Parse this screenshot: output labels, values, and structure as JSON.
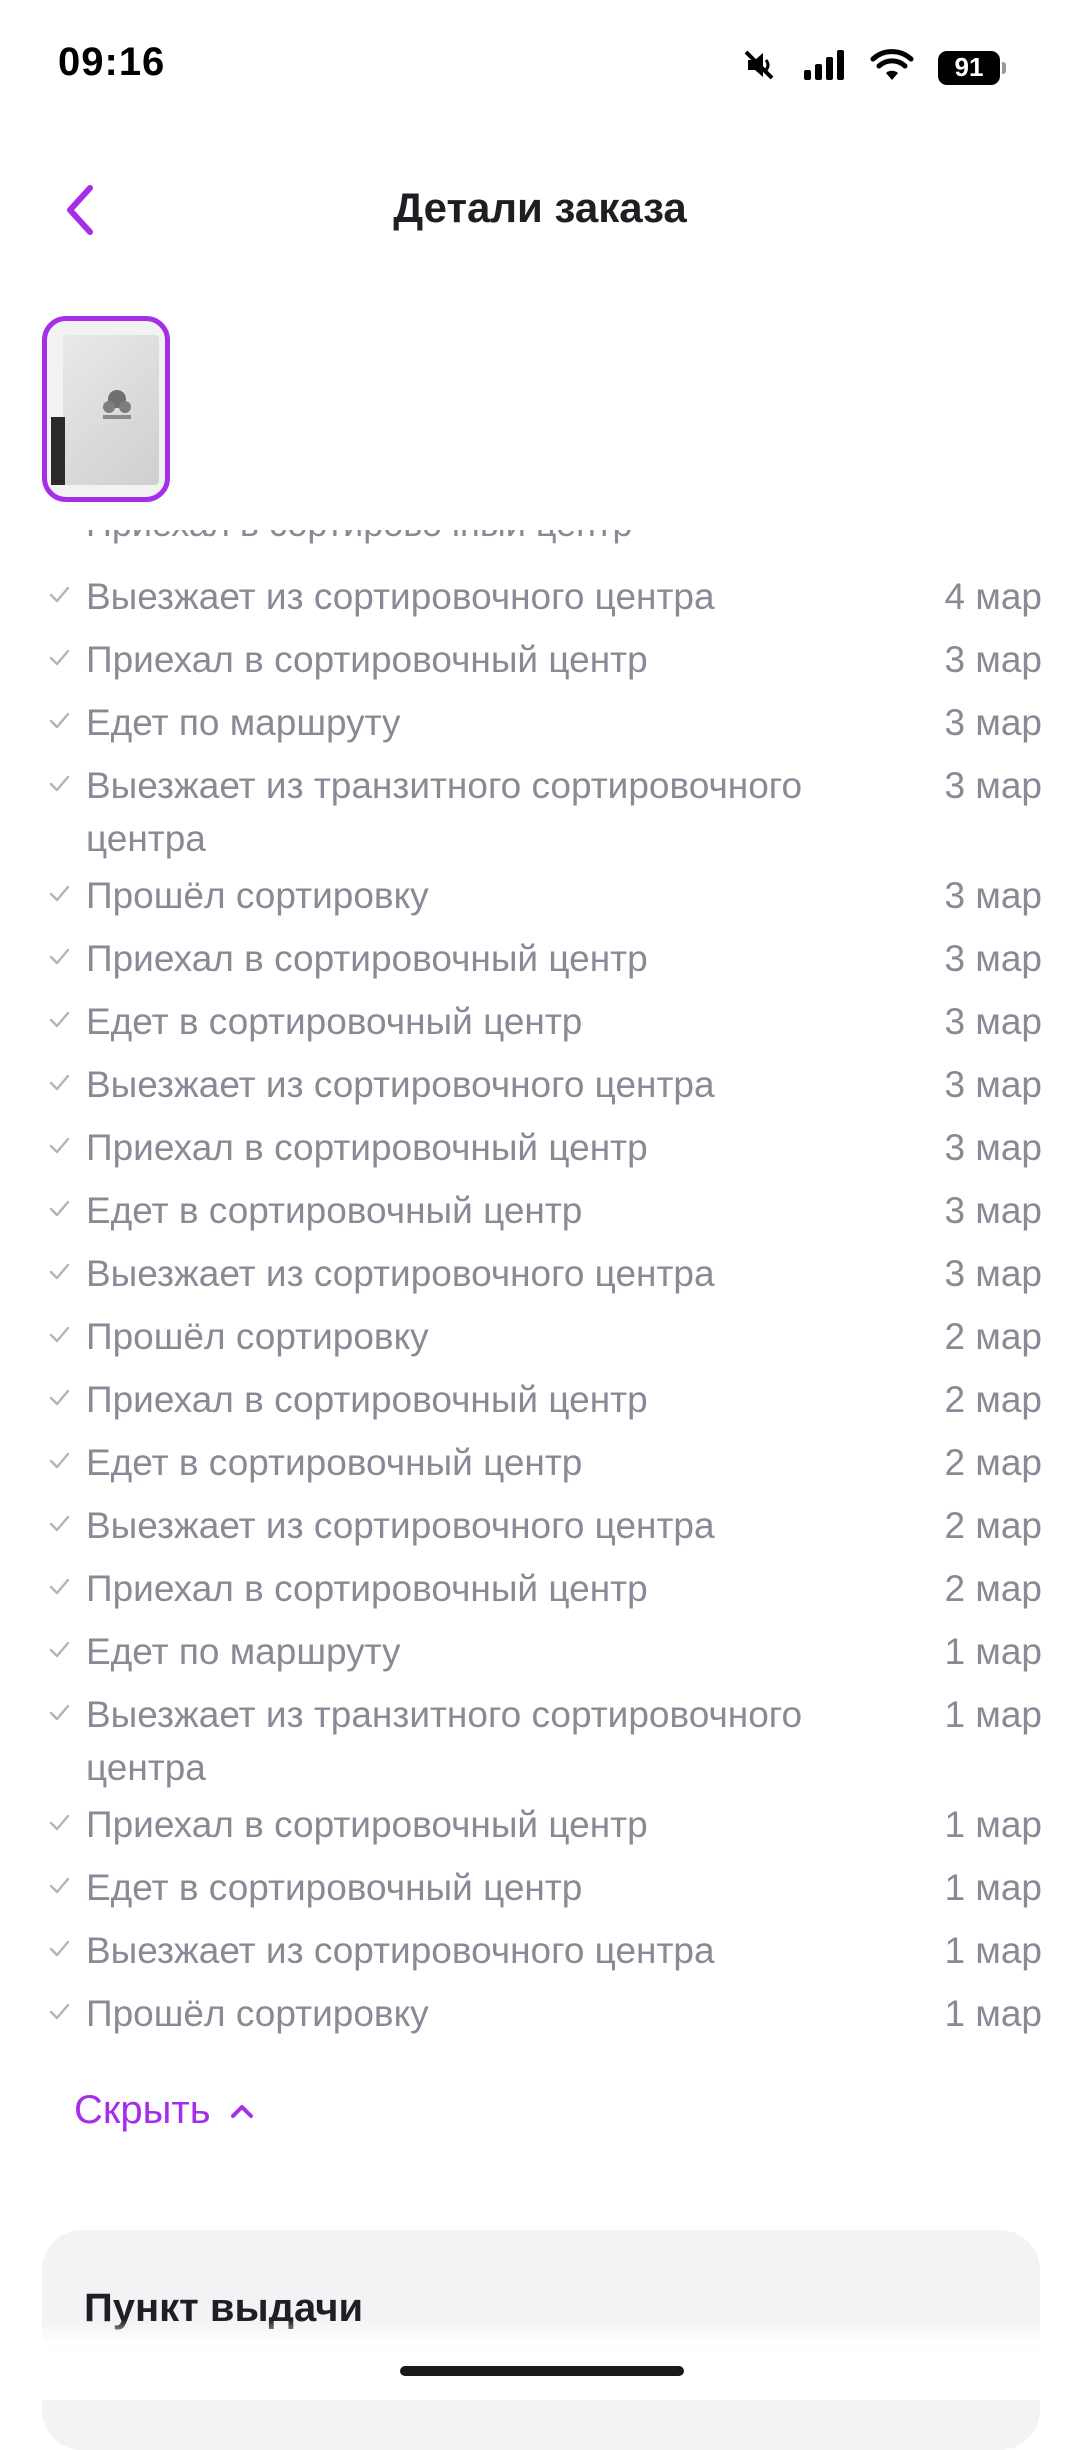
{
  "status_bar": {
    "time": "09:16",
    "battery": "91"
  },
  "header": {
    "title": "Детали заказа"
  },
  "colors": {
    "accent": "#a52ee8",
    "muted_text": "#8a8a96",
    "card_bg": "#f3f3f6"
  },
  "timeline": {
    "cut_off_row": "Приехал в сортировочный центр",
    "events": [
      {
        "text": "Выезжает из сортировочного центра",
        "date": "4 мар"
      },
      {
        "text": "Приехал в сортировочный центр",
        "date": "3 мар"
      },
      {
        "text": "Едет по маршруту",
        "date": "3 мар"
      },
      {
        "text": "Выезжает из транзитного сортировочного центра",
        "date": "3 мар"
      },
      {
        "text": "Прошёл сортировку",
        "date": "3 мар"
      },
      {
        "text": "Приехал в сортировочный центр",
        "date": "3 мар"
      },
      {
        "text": "Едет в сортировочный центр",
        "date": "3 мар"
      },
      {
        "text": "Выезжает из сортировочного центра",
        "date": "3 мар"
      },
      {
        "text": "Приехал в сортировочный центр",
        "date": "3 мар"
      },
      {
        "text": "Едет в сортировочный центр",
        "date": "3 мар"
      },
      {
        "text": "Выезжает из сортировочного центра",
        "date": "3 мар"
      },
      {
        "text": "Прошёл сортировку",
        "date": "2 мар"
      },
      {
        "text": "Приехал в сортировочный центр",
        "date": "2 мар"
      },
      {
        "text": "Едет в сортировочный центр",
        "date": "2 мар"
      },
      {
        "text": "Выезжает из сортировочного центра",
        "date": "2 мар"
      },
      {
        "text": "Приехал в сортировочный центр",
        "date": "2 мар"
      },
      {
        "text": "Едет по маршруту",
        "date": "1 мар"
      },
      {
        "text": "Выезжает из транзитного сортировочного центра",
        "date": "1 мар"
      },
      {
        "text": "Приехал в сортировочный центр",
        "date": "1 мар"
      },
      {
        "text": "Едет в сортировочный центр",
        "date": "1 мар"
      },
      {
        "text": "Выезжает из сортировочного центра",
        "date": "1 мар"
      },
      {
        "text": "Прошёл сортировку",
        "date": "1 мар"
      }
    ],
    "hide_label": "Скрыть"
  },
  "pickup": {
    "title": "Пункт выдачи"
  },
  "icons": {
    "back": "chevron-left-icon",
    "check": "check-icon",
    "hide": "chevron-up-icon"
  }
}
